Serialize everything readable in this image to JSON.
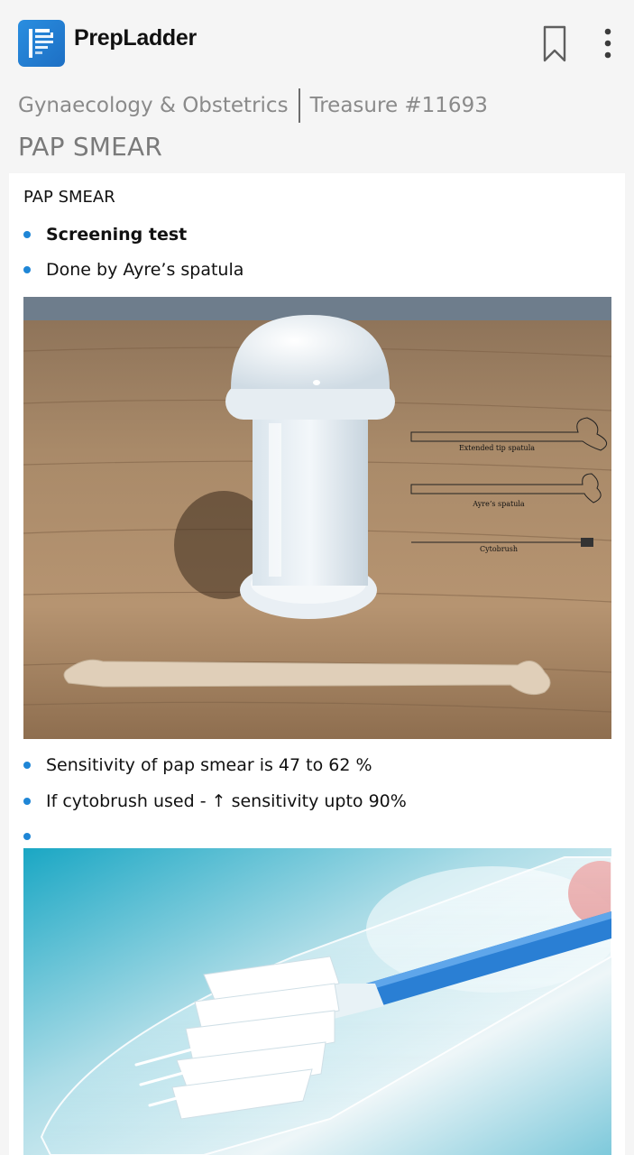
{
  "app": {
    "brand": "PrepLadder",
    "icons": [
      "prepladder-logo-icon",
      "bookmark-icon",
      "more-vert-icon"
    ]
  },
  "breadcrumb": {
    "subject": "Gynaecology & Obstetrics",
    "treasure": "Treasure #11693"
  },
  "page_title": "PAP SMEAR",
  "content": {
    "heading": "PAP SMEAR",
    "bullets_top": [
      {
        "text": "Screening test",
        "bold": true
      },
      {
        "text": "Done by Ayre’s spatula",
        "bold": false
      }
    ],
    "image1": {
      "labels": [
        "Extended tip spatula",
        "Ayre’s spatula",
        "Cytobrush"
      ]
    },
    "bullets_bottom": [
      {
        "text": "Sensitivity of pap smear is 47 to 62 %"
      },
      {
        "text": "If cytobrush used - ↑ sensitivity upto 90%"
      },
      {
        "text": ""
      }
    ]
  },
  "colors": {
    "accent": "#1f86d6",
    "logo": "#2a8ee0",
    "background": "#f5f5f5",
    "card": "#ffffff"
  }
}
